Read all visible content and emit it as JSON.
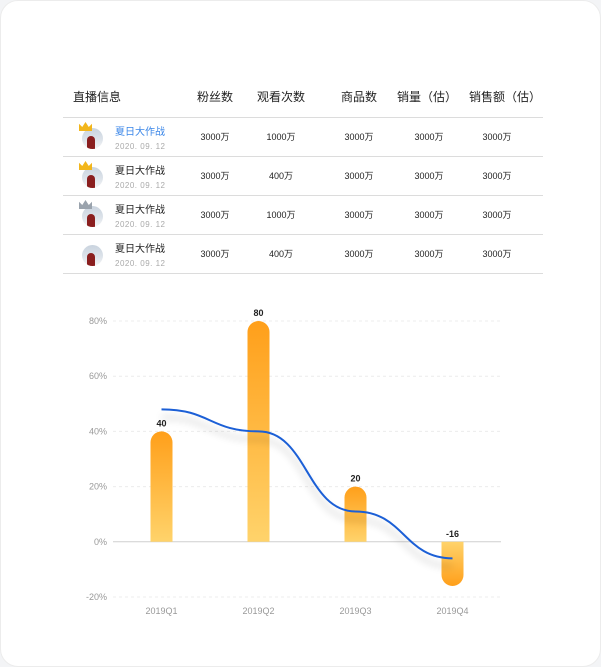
{
  "table": {
    "headers": [
      "直播信息",
      "粉丝数",
      "观看次数",
      "商品数",
      "销量（估）",
      "销售额（估）"
    ],
    "rows": [
      {
        "title": "夏日大作战",
        "date": "2020. 09. 12",
        "fans": "3000万",
        "views": "1000万",
        "products": "3000万",
        "sales": "3000万",
        "revenue": "3000万",
        "crown": "gold-crown-icon",
        "crown_color": "#f2b61c",
        "active": true
      },
      {
        "title": "夏日大作战",
        "date": "2020. 09. 12",
        "fans": "3000万",
        "views": "400万",
        "products": "3000万",
        "sales": "3000万",
        "revenue": "3000万",
        "crown": "gold-crown-icon",
        "crown_color": "#f2b61c",
        "active": false
      },
      {
        "title": "夏日大作战",
        "date": "2020. 09. 12",
        "fans": "3000万",
        "views": "1000万",
        "products": "3000万",
        "sales": "3000万",
        "revenue": "3000万",
        "crown": "silver-crown-icon",
        "crown_color": "#9aa3ad",
        "active": false
      },
      {
        "title": "夏日大作战",
        "date": "2020. 09. 12",
        "fans": "3000万",
        "views": "400万",
        "products": "3000万",
        "sales": "3000万",
        "revenue": "3000万",
        "crown": "",
        "crown_color": "",
        "active": false
      }
    ]
  },
  "colors": {
    "active_link": "#3a86e8",
    "bar_top": "#ff9f1a",
    "bar_bottom": "#ffd36b",
    "line": "#1a5fd6"
  },
  "chart_data": {
    "type": "bar",
    "categories": [
      "2019Q1",
      "2019Q2",
      "2019Q3",
      "2019Q4"
    ],
    "series": [
      {
        "type": "bar",
        "values": [
          40,
          80,
          20,
          -16
        ]
      },
      {
        "type": "line",
        "smooth": true,
        "values": [
          48,
          40,
          11,
          -6
        ]
      }
    ],
    "data_labels": [
      "40",
      "80",
      "20",
      "-16"
    ],
    "ylim": [
      -20,
      80
    ],
    "yticks": [
      "80%",
      "60%",
      "40%",
      "20%",
      "0%",
      "-20%"
    ],
    "ytick_values": [
      80,
      60,
      40,
      20,
      0,
      -20
    ],
    "grid": true
  }
}
